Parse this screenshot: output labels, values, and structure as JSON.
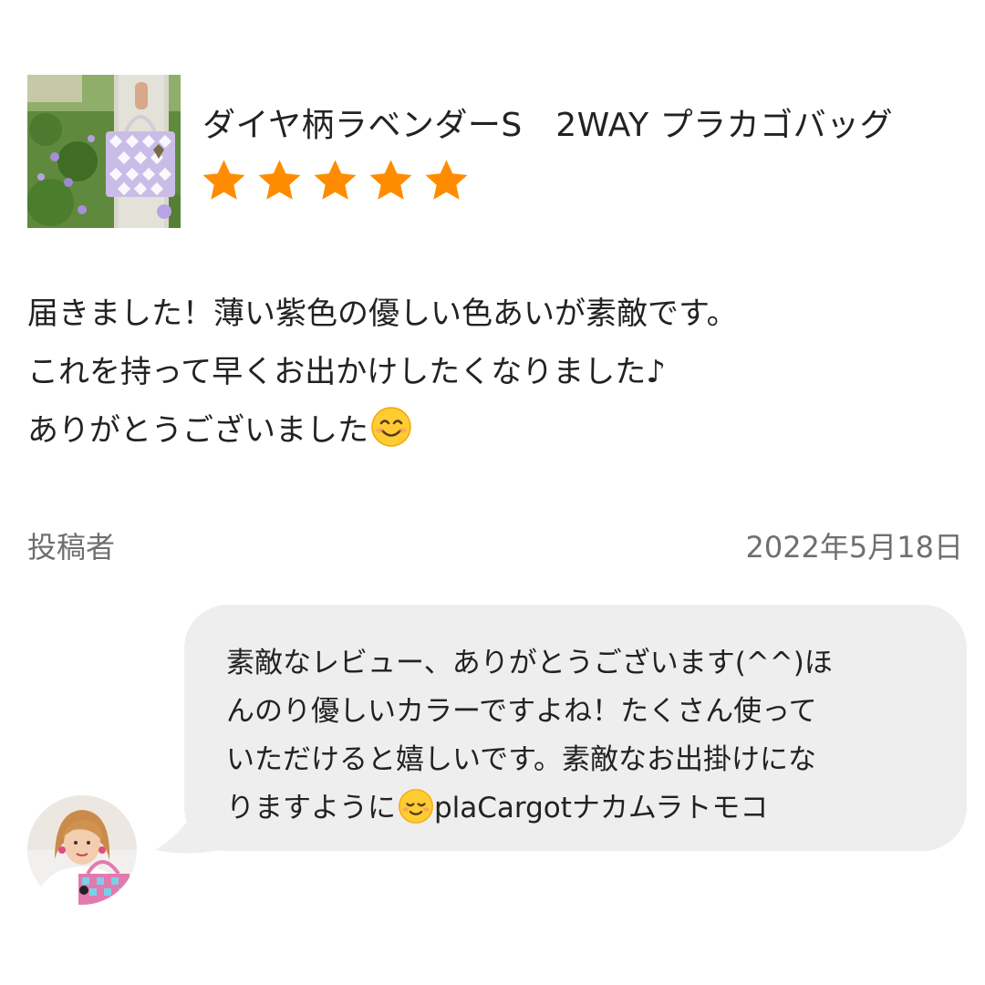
{
  "product": {
    "title": "ダイヤ柄ラベンダーS　2WAY プラカゴバッグ",
    "rating": 5,
    "max_rating": 5,
    "star_color": "#ff8c00",
    "thumbnail_icon": "product-photo-lavender-bag"
  },
  "review": {
    "lines": [
      "届きました！薄い紫色の優しい色あいが素敵です。",
      "これを持って早くお出かけしたくなりました♪",
      "ありがとうございました"
    ],
    "trailing_emoji": "smiling-face-emoji"
  },
  "meta": {
    "poster_label": "投稿者",
    "date": "2022年5月18日"
  },
  "reply": {
    "lines": [
      "素敵なレビュー、ありがとうございます(^^)ほ",
      "んのり優しいカラーですよね！たくさん使って",
      "いただけると嬉しいです。素敵なお出掛けにな"
    ],
    "last_line_before_emoji": "りますように",
    "last_line_after_emoji": "plaCargotナカムラトモコ",
    "emoji": "relieved-smile-emoji",
    "bubble_color": "#eeeeee",
    "avatar_icon": "shop-staff-avatar"
  }
}
